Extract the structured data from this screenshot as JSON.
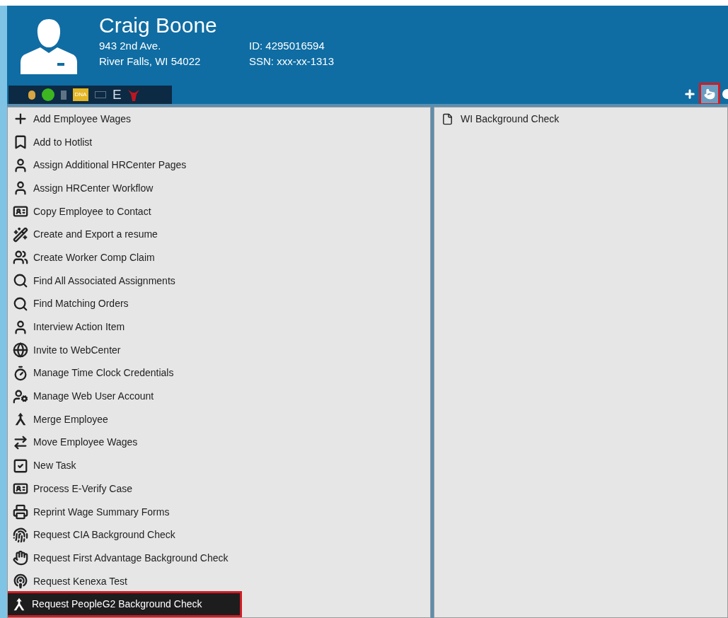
{
  "header": {
    "name": "Craig Boone",
    "address_line_1": "943 2nd Ave.",
    "address_line_2": "River Falls, WI 54022",
    "id": "ID: 4295016594",
    "ssn": "SSN: xxx-xx-1313"
  },
  "status_toolbar": {
    "dna_badge": "DNA",
    "letter_badge": "E"
  },
  "action_toolbar": [
    {
      "kind": "add",
      "selected": false
    },
    {
      "kind": "pointer",
      "selected": true
    },
    {
      "kind": "partial",
      "selected": false
    }
  ],
  "actions": [
    {
      "label": "Add Employee Wages",
      "selected": false
    },
    {
      "label": "Add to Hotlist",
      "selected": false
    },
    {
      "label": "Assign Additional HRCenter Pages",
      "selected": false
    },
    {
      "label": "Assign HRCenter Workflow",
      "selected": false
    },
    {
      "label": "Copy Employee to Contact",
      "selected": false
    },
    {
      "label": "Create and Export a resume",
      "selected": false
    },
    {
      "label": "Create Worker Comp Claim",
      "selected": false
    },
    {
      "label": "Find All Associated Assignments",
      "selected": false
    },
    {
      "label": "Find Matching Orders",
      "selected": false
    },
    {
      "label": "Interview Action Item",
      "selected": false
    },
    {
      "label": "Invite to WebCenter",
      "selected": false
    },
    {
      "label": "Manage Time Clock Credentials",
      "selected": false
    },
    {
      "label": "Manage Web User Account",
      "selected": false
    },
    {
      "label": "Merge Employee",
      "selected": false
    },
    {
      "label": "Move Employee Wages",
      "selected": false
    },
    {
      "label": "New Task",
      "selected": false
    },
    {
      "label": "Process E-Verify Case",
      "selected": false
    },
    {
      "label": "Reprint Wage Summary Forms",
      "selected": false
    },
    {
      "label": "Request CIA Background Check",
      "selected": false
    },
    {
      "label": "Request First Advantage Background Check",
      "selected": false
    },
    {
      "label": "Request Kenexa Test",
      "selected": false
    },
    {
      "label": "Request PeopleG2 Background Check",
      "selected": true
    }
  ],
  "documents": [
    {
      "label": "WI Background Check"
    }
  ]
}
